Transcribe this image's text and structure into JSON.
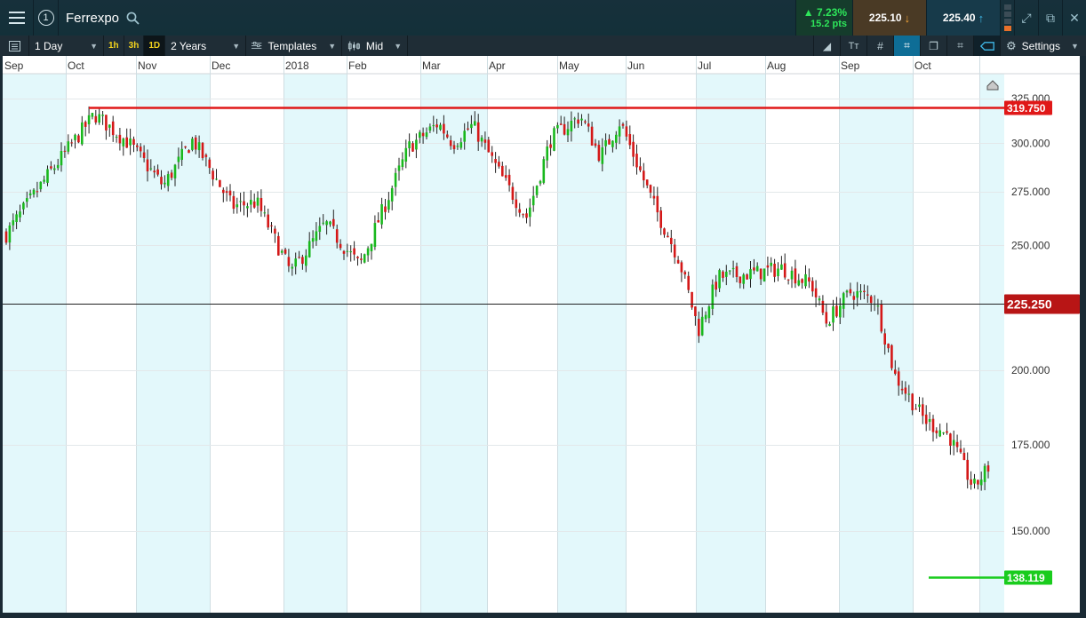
{
  "header": {
    "instrument": "Ferrexpo",
    "window_number": "1",
    "change_pct": "▲ 7.23%",
    "change_pts": "15.2 pts",
    "sell_price": "225.10",
    "buy_price": "225.40",
    "icons": [
      "menu-icon",
      "search-icon",
      "expand-icon",
      "popout-icon",
      "close-icon"
    ]
  },
  "toolbar": {
    "interval": "1 Day",
    "timeframes": [
      "1h",
      "3h",
      "1D"
    ],
    "active_timeframe": "1D",
    "period": "2 Years",
    "templates_label": "Templates",
    "price_type": "Mid",
    "settings_label": "Settings"
  },
  "colors": {
    "up": "#19b81d",
    "down": "#d41818",
    "resistance": "#e01818",
    "support": "#19cc1d",
    "current_price_tag": "#b81515",
    "month_band": "#e3f8fb"
  },
  "chart_data": {
    "type": "candlestick",
    "title": "",
    "xlabel": "",
    "ylabel": "",
    "x_ticks": [
      "Sep",
      "Oct",
      "Nov",
      "Dec",
      "2018",
      "Feb",
      "Mar",
      "Apr",
      "May",
      "Jun",
      "Jul",
      "Aug",
      "Sep",
      "Oct"
    ],
    "y_ticks": [
      "325.000",
      "300.000",
      "275.000",
      "250.000",
      "200.000",
      "175.000",
      "150.000"
    ],
    "ylim": [
      135,
      335
    ],
    "y_scale": "log",
    "grid": true,
    "price_levels": [
      {
        "label": "319.750",
        "value": 319.75,
        "kind": "resistance"
      },
      {
        "label": "225.250",
        "value": 225.25,
        "kind": "current"
      },
      {
        "label": "138.119",
        "value": 138.119,
        "kind": "support"
      }
    ],
    "path_anchors": [
      {
        "t": 0,
        "price": 255
      },
      {
        "t": 0.045,
        "price": 285
      },
      {
        "t": 0.09,
        "price": 316
      },
      {
        "t": 0.125,
        "price": 300
      },
      {
        "t": 0.16,
        "price": 278
      },
      {
        "t": 0.19,
        "price": 302
      },
      {
        "t": 0.23,
        "price": 268
      },
      {
        "t": 0.255,
        "price": 270
      },
      {
        "t": 0.29,
        "price": 238
      },
      {
        "t": 0.325,
        "price": 260
      },
      {
        "t": 0.36,
        "price": 241
      },
      {
        "t": 0.41,
        "price": 298
      },
      {
        "t": 0.44,
        "price": 311
      },
      {
        "t": 0.455,
        "price": 300
      },
      {
        "t": 0.475,
        "price": 310
      },
      {
        "t": 0.505,
        "price": 282
      },
      {
        "t": 0.53,
        "price": 263
      },
      {
        "t": 0.555,
        "price": 303
      },
      {
        "t": 0.585,
        "price": 315
      },
      {
        "t": 0.605,
        "price": 293
      },
      {
        "t": 0.625,
        "price": 312
      },
      {
        "t": 0.66,
        "price": 268
      },
      {
        "t": 0.685,
        "price": 244
      },
      {
        "t": 0.705,
        "price": 215
      },
      {
        "t": 0.725,
        "price": 236
      },
      {
        "t": 0.765,
        "price": 238
      },
      {
        "t": 0.79,
        "price": 240
      },
      {
        "t": 0.82,
        "price": 233
      },
      {
        "t": 0.835,
        "price": 218
      },
      {
        "t": 0.86,
        "price": 230
      },
      {
        "t": 0.885,
        "price": 227
      },
      {
        "t": 0.905,
        "price": 198
      },
      {
        "t": 0.935,
        "price": 183
      },
      {
        "t": 0.96,
        "price": 178
      },
      {
        "t": 0.985,
        "price": 162
      },
      {
        "t": 1.0,
        "price": 168
      }
    ]
  }
}
